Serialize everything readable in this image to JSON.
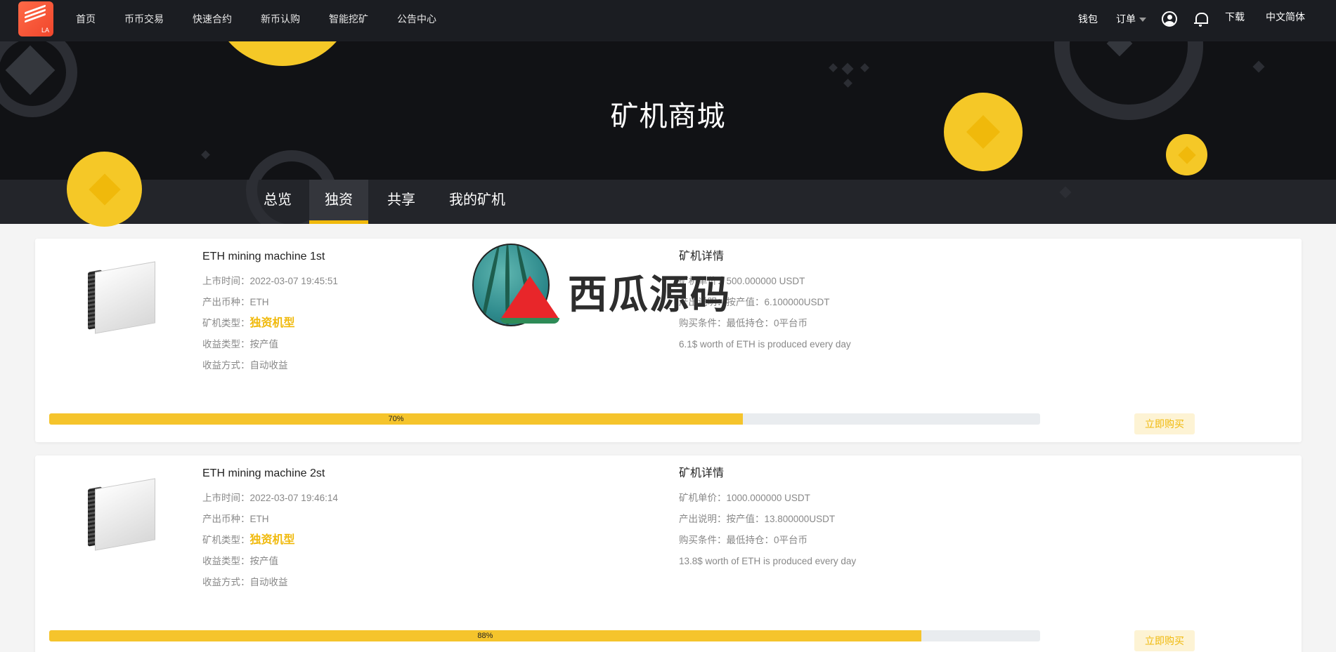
{
  "nav": {
    "logo_text": "LA",
    "links": [
      "首页",
      "币币交易",
      "快速合约",
      "新币认购",
      "智能挖矿",
      "公告中心"
    ],
    "wallet": "钱包",
    "orders": "订单",
    "download": "下载",
    "language": "中文简体"
  },
  "banner": {
    "title": "矿机商城"
  },
  "tabs": [
    "总览",
    "独资",
    "共享",
    "我的矿机"
  ],
  "active_tab": "独资",
  "machines": [
    {
      "name": "ETH mining machine 1st",
      "listed_label": "上市时间：",
      "listed": "2022-03-07 19:45:51",
      "coin_label": "产出币种：",
      "coin": "ETH",
      "type_label": "矿机类型：",
      "type": "独资机型",
      "income_type_label": "收益类型：",
      "income_type": "按产值",
      "income_method_label": "收益方式：",
      "income_method": "自动收益",
      "detail_title": "矿机详情",
      "price_label": "矿机单价：",
      "price": "500.000000 USDT",
      "output_label": "产出说明：",
      "output": "按产值：6.100000USDT",
      "condition_label": "购买条件：",
      "condition": "最低持仓：0平台币",
      "note": "6.1$ worth of ETH is produced every day",
      "progress": 70,
      "progress_text": "70%",
      "buy_label": "立即购买"
    },
    {
      "name": "ETH mining machine 2st",
      "listed_label": "上市时间：",
      "listed": "2022-03-07 19:46:14",
      "coin_label": "产出币种：",
      "coin": "ETH",
      "type_label": "矿机类型：",
      "type": "独资机型",
      "income_type_label": "收益类型：",
      "income_type": "按产值",
      "income_method_label": "收益方式：",
      "income_method": "自动收益",
      "detail_title": "矿机详情",
      "price_label": "矿机单价：",
      "price": "1000.000000 USDT",
      "output_label": "产出说明：",
      "output": "按产值：13.800000USDT",
      "condition_label": "购买条件：",
      "condition": "最低持仓：0平台币",
      "note": "13.8$ worth of ETH is produced every day",
      "progress": 88,
      "progress_text": "88%",
      "buy_label": "立即购买"
    }
  ],
  "watermark": {
    "text": "西瓜源码"
  },
  "colors": {
    "accent": "#f0b90b",
    "nav_bg": "#1b1d22",
    "banner_bg": "#111215",
    "coin": "#f5c827"
  },
  "icons": [
    "user-icon",
    "bell-icon",
    "caret-down-icon",
    "watermelon-icon"
  ]
}
